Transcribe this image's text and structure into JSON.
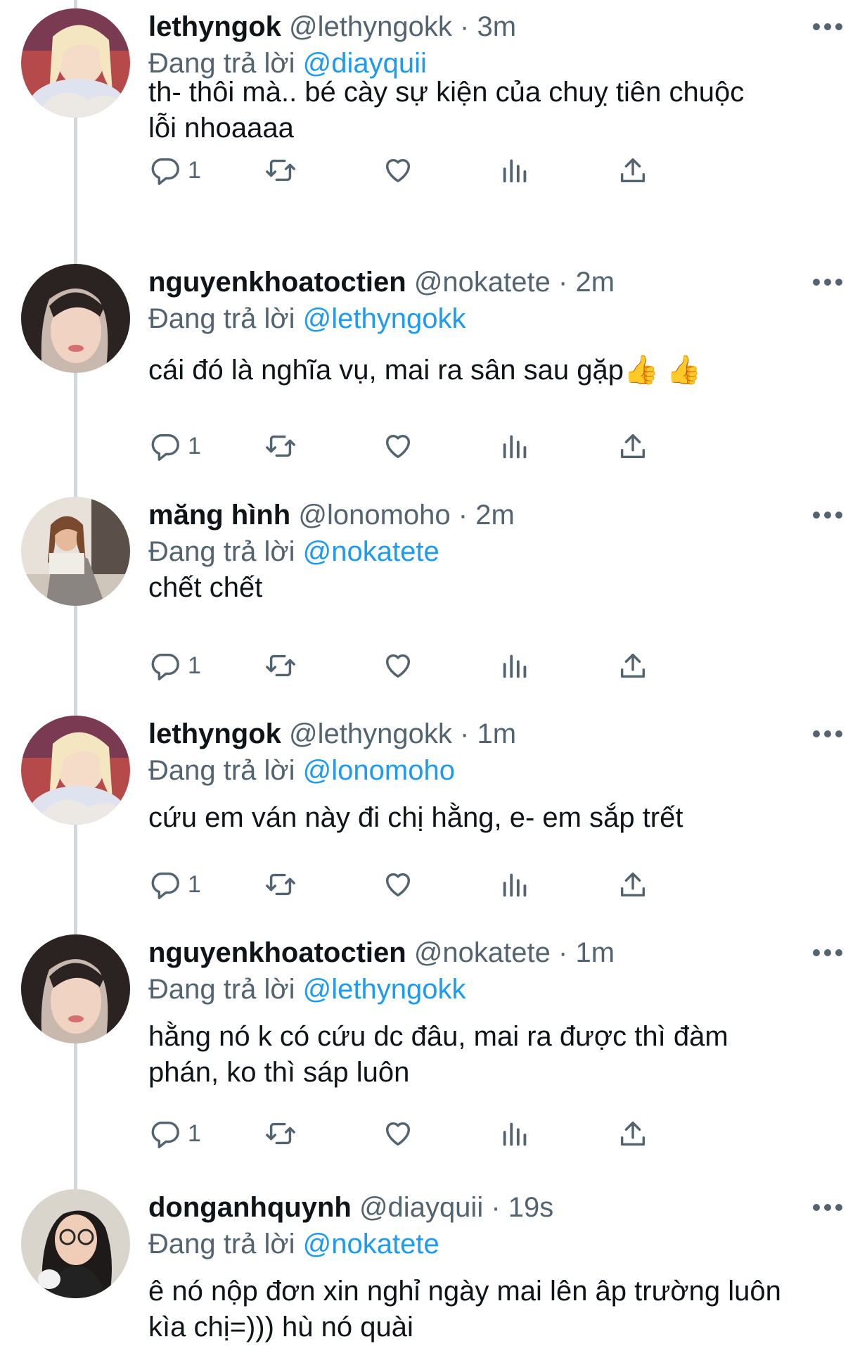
{
  "colors": {
    "link": "#1d9bf0",
    "secondary": "#536471",
    "text": "#0f1419",
    "thread": "#cfd9de"
  },
  "icons": [
    "reply-icon",
    "retweet-icon",
    "like-icon",
    "views-icon",
    "share-icon",
    "more-icon"
  ],
  "replying_prefix": "Đang trả lời",
  "tweets": [
    {
      "name": "lethyngok",
      "handle": "@lethyngokk",
      "time": "3m",
      "reply_to": "@diayquii",
      "text_lines": [
        "th- thôi mà.. bé cày sự kiện của chuỵ tiên chuộc",
        "lỗi nhoaaaa"
      ],
      "reply_count": "1"
    },
    {
      "name": "nguyenkhoatoctien",
      "handle": "@nokatete",
      "time": "2m",
      "reply_to": "@lethyngokk",
      "text_lines": [
        "cái đó là nghĩa vụ, mai ra sân sau gặp👍 👍"
      ],
      "reply_count": "1"
    },
    {
      "name": "măng hình",
      "handle": "@lonomoho",
      "time": "2m",
      "reply_to": "@nokatete",
      "text_lines": [
        "chết chết"
      ],
      "reply_count": "1"
    },
    {
      "name": "lethyngok",
      "handle": "@lethyngokk",
      "time": "1m",
      "reply_to": "@lonomoho",
      "text_lines": [
        "cứu em ván này đi chị hằng, e- em sắp trết"
      ],
      "reply_count": "1"
    },
    {
      "name": "nguyenkhoatoctien",
      "handle": "@nokatete",
      "time": "1m",
      "reply_to": "@lethyngokk",
      "text_lines": [
        "hằng nó k có cứu dc đâu, mai ra được thì đàm",
        "phán, ko thì sáp luôn"
      ],
      "reply_count": "1"
    },
    {
      "name": "donganhquynh",
      "handle": "@diayquii",
      "time": "19s",
      "reply_to": "@nokatete",
      "text_lines": [
        "ê nó nộp đơn xin nghỉ ngày mai lên âp trường luôn",
        "kìa chị=))) hù nó quài"
      ],
      "reply_count": ""
    }
  ]
}
